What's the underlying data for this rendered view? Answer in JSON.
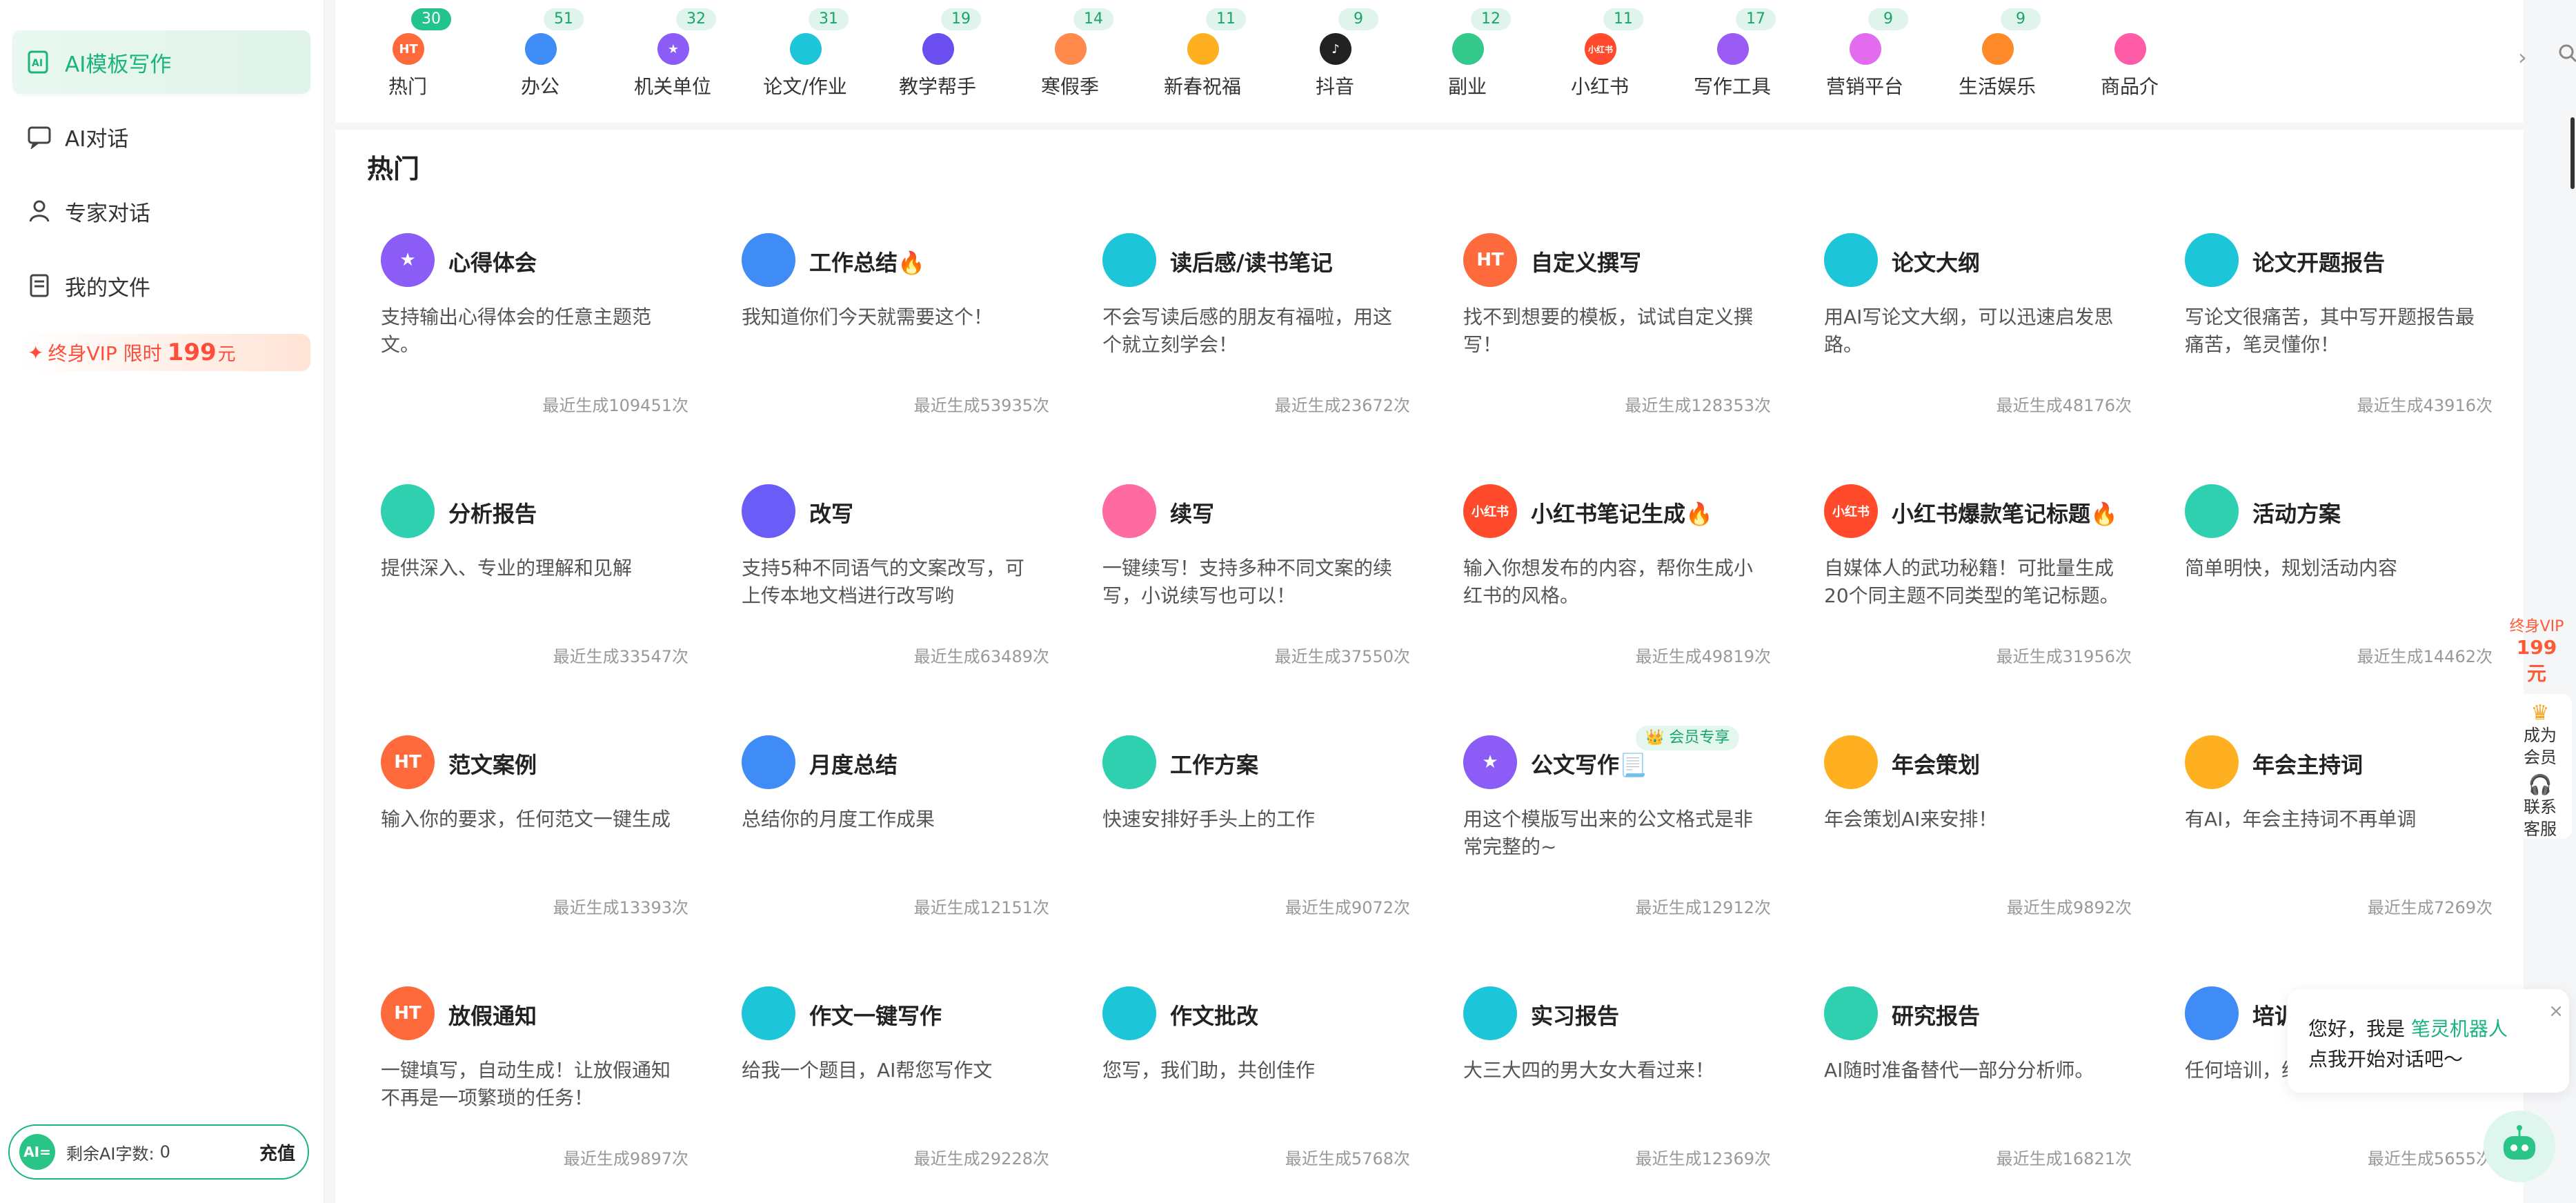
{
  "sidebar": {
    "items": [
      {
        "label": "AI模板写作",
        "icon": "template-write-icon"
      },
      {
        "label": "AI对话",
        "icon": "chat-icon"
      },
      {
        "label": "专家对话",
        "icon": "expert-icon"
      },
      {
        "label": "我的文件",
        "icon": "file-icon"
      }
    ],
    "vip": {
      "label": "终身VIP 限时",
      "price": "199",
      "unit": "元"
    },
    "words": {
      "badge": "AI=",
      "label": "剩余AI字数:",
      "count": "0",
      "recharge": "充值"
    }
  },
  "categories": [
    {
      "label": "热门",
      "badge": "30",
      "icon": "HT",
      "color": "#ff6a3d",
      "hot": true
    },
    {
      "label": "办公",
      "badge": "51",
      "icon": "",
      "color": "#3f8cf7"
    },
    {
      "label": "机关单位",
      "badge": "32",
      "icon": "★",
      "color": "#8b5cf6"
    },
    {
      "label": "论文/作业",
      "badge": "31",
      "icon": "",
      "color": "#1cc6d8"
    },
    {
      "label": "教学帮手",
      "badge": "19",
      "icon": "",
      "color": "#6b4ef0"
    },
    {
      "label": "寒假季",
      "badge": "14",
      "icon": "",
      "color": "#ff8a4c"
    },
    {
      "label": "新春祝福",
      "badge": "11",
      "icon": "",
      "color": "#ffb020"
    },
    {
      "label": "抖音",
      "badge": "9",
      "icon": "♪",
      "color": "#222222"
    },
    {
      "label": "副业",
      "badge": "12",
      "icon": "",
      "color": "#34c98a"
    },
    {
      "label": "小红书",
      "badge": "11",
      "icon": "小红书",
      "color": "#ff4b2b"
    },
    {
      "label": "写作工具",
      "badge": "17",
      "icon": "",
      "color": "#9b5cf6"
    },
    {
      "label": "营销平台",
      "badge": "9",
      "icon": "",
      "color": "#e36bf0"
    },
    {
      "label": "生活娱乐",
      "badge": "9",
      "icon": "",
      "color": "#ff8a2a"
    },
    {
      "label": "商品介",
      "badge": "",
      "icon": "",
      "color": "#ff5ca8"
    }
  ],
  "search": {
    "placeholder": "搜索"
  },
  "section_title": "热门",
  "cards": [
    {
      "title": "心得体会",
      "desc": "支持输出心得体会的任意主题范文。",
      "count": "最近生成109451次",
      "icon": "★",
      "color": "#8b5cf6"
    },
    {
      "title": "工作总结🔥",
      "desc": "我知道你们今天就需要这个！",
      "count": "最近生成53935次",
      "icon": "",
      "color": "#3f8cf7"
    },
    {
      "title": "读后感/读书笔记",
      "desc": "不会写读后感的朋友有福啦，用这个就立刻学会！",
      "count": "最近生成23672次",
      "icon": "",
      "color": "#1cc6d8"
    },
    {
      "title": "自定义撰写",
      "desc": "找不到想要的模板，试试自定义撰写！",
      "count": "最近生成128353次",
      "icon": "HT",
      "color": "#ff6a3d"
    },
    {
      "title": "论文大纲",
      "desc": "用AI写论文大纲，可以迅速启发思路。",
      "count": "最近生成48176次",
      "icon": "",
      "color": "#1cc6d8"
    },
    {
      "title": "论文开题报告",
      "desc": "写论文很痛苦，其中写开题报告最痛苦，笔灵懂你！",
      "count": "最近生成43916次",
      "icon": "",
      "color": "#1cc6d8"
    },
    {
      "title": "分析报告",
      "desc": "提供深入、专业的理解和见解",
      "count": "最近生成33547次",
      "icon": "",
      "color": "#2fd0b0"
    },
    {
      "title": "改写",
      "desc": "支持5种不同语气的文案改写，可上传本地文档进行改写哟",
      "count": "最近生成63489次",
      "icon": "",
      "color": "#6a5cf6"
    },
    {
      "title": "续写",
      "desc": "一键续写！支持多种不同文案的续写，小说续写也可以！",
      "count": "最近生成37550次",
      "icon": "",
      "color": "#ff6aa0"
    },
    {
      "title": "小红书笔记生成🔥",
      "desc": "输入你想发布的内容，帮你生成小红书的风格。",
      "count": "最近生成49819次",
      "icon": "小红书",
      "color": "#ff4b2b"
    },
    {
      "title": "小红书爆款笔记标题🔥",
      "desc": "自媒体人的武功秘籍！可批量生成20个同主题不同类型的笔记标题。",
      "count": "最近生成31956次",
      "icon": "小红书",
      "color": "#ff4b2b"
    },
    {
      "title": "活动方案",
      "desc": "简单明快，规划活动内容",
      "count": "最近生成14462次",
      "icon": "",
      "color": "#2fd0b0"
    },
    {
      "title": "范文案例",
      "desc": "输入你的要求，任何范文一键生成",
      "count": "最近生成13393次",
      "icon": "HT",
      "color": "#ff6a3d"
    },
    {
      "title": "月度总结",
      "desc": "总结你的月度工作成果",
      "count": "最近生成12151次",
      "icon": "",
      "color": "#3f8cf7"
    },
    {
      "title": "工作方案",
      "desc": "快速安排好手头上的工作",
      "count": "最近生成9072次",
      "icon": "",
      "color": "#2fd0b0"
    },
    {
      "title": "公文写作📃",
      "desc": "用这个模版写出来的公文格式是非常完整的~",
      "count": "最近生成12912次",
      "icon": "★",
      "color": "#8b5cf6",
      "tag": "👑 会员专享"
    },
    {
      "title": "年会策划",
      "desc": "年会策划AI来安排！",
      "count": "最近生成9892次",
      "icon": "",
      "color": "#ffb020"
    },
    {
      "title": "年会主持词",
      "desc": "有AI，年会主持词不再单调",
      "count": "最近生成7269次",
      "icon": "",
      "color": "#ffb020"
    },
    {
      "title": "放假通知",
      "desc": "一键填写，自动生成！让放假通知不再是一项繁琐的任务！",
      "count": "最近生成9897次",
      "icon": "HT",
      "color": "#ff6a3d"
    },
    {
      "title": "作文一键写作",
      "desc": "给我一个题目，AI帮您写作文",
      "count": "最近生成29228次",
      "icon": "",
      "color": "#1cc6d8"
    },
    {
      "title": "作文批改",
      "desc": "您写，我们助，共创佳作",
      "count": "最近生成5768次",
      "icon": "",
      "color": "#1cc6d8"
    },
    {
      "title": "实习报告",
      "desc": "大三大四的男大女大看过来！",
      "count": "最近生成12369次",
      "icon": "",
      "color": "#1cc6d8"
    },
    {
      "title": "研究报告",
      "desc": "AI随时准备替代一部分分析师。",
      "count": "最近生成16821次",
      "icon": "",
      "color": "#2fd0b0"
    },
    {
      "title": "培训总",
      "desc": "任何培训，给你",
      "count": "最近生成5655次",
      "icon": "",
      "color": "#3f8cf7"
    }
  ],
  "rightbar": {
    "vip_label": "终身VIP",
    "vip_price": "199元",
    "member_label": "成为会员",
    "service_label": "联系客服"
  },
  "chat_tip": {
    "prefix": "您好，我是 ",
    "name": "笔灵机器人",
    "line2": "点我开始对话吧～",
    "close": "×"
  }
}
